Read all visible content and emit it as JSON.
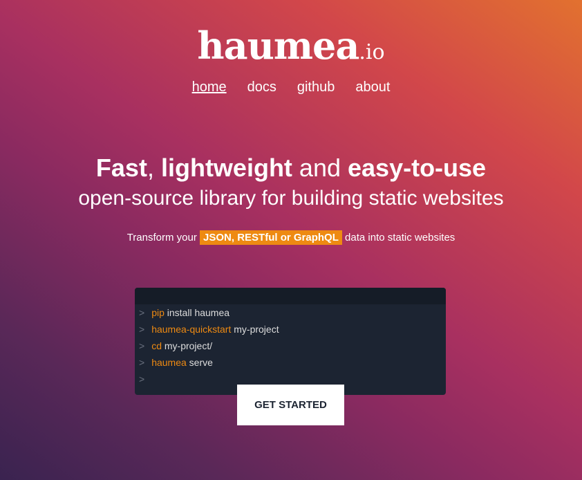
{
  "logo": {
    "name": "haumea",
    "tld": ".io"
  },
  "nav": [
    {
      "label": "home",
      "active": true
    },
    {
      "label": "docs"
    },
    {
      "label": "github"
    },
    {
      "label": "about"
    }
  ],
  "hero": {
    "w1": "Fast",
    "sep1": ", ",
    "w2": "lightweight",
    "sep2": " and ",
    "w3": "easy-to-use",
    "line2": "open-source library for building static websites"
  },
  "subtitle": {
    "before": "Transform your ",
    "highlight": "JSON, RESTful or GraphQL",
    "after": " data into static websites"
  },
  "terminal": {
    "prompt": ">",
    "lines": [
      {
        "cmd": "pip",
        "args": " install haumea"
      },
      {
        "cmd": "haumea-quickstart",
        "args": " my-project"
      },
      {
        "cmd": "cd",
        "args": " my-project/"
      },
      {
        "cmd": "haumea",
        "args": " serve"
      },
      {
        "cmd": "",
        "args": ""
      }
    ]
  },
  "cta": "GET STARTED",
  "colors": {
    "accent": "#ee8a12",
    "terminal_bg": "#1c2432"
  }
}
